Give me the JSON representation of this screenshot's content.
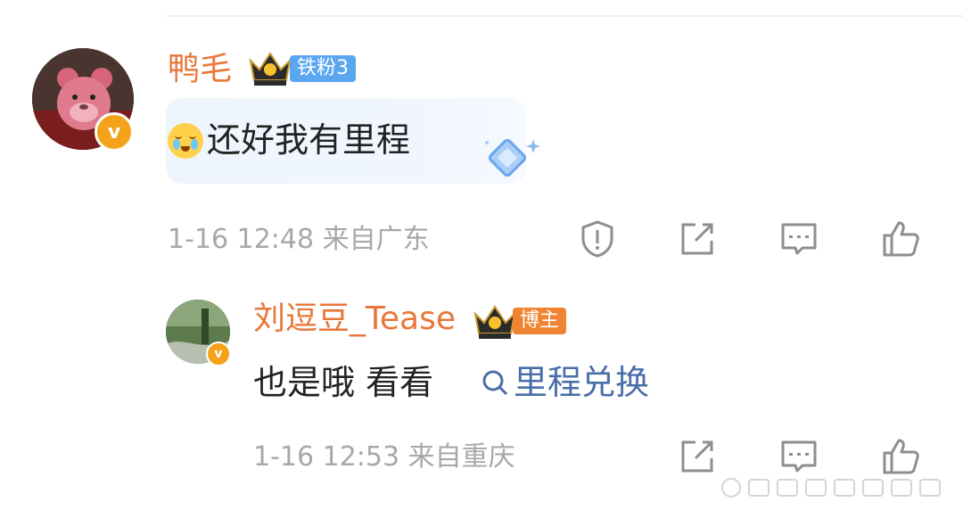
{
  "comment": {
    "username": "鸭毛",
    "fan_badge": "铁粉3",
    "text": "还好我有里程",
    "meta": "1-16 12:48 来自广东"
  },
  "reply": {
    "username": "刘逗豆_Tease",
    "host_badge": "博主",
    "text": "也是哦  看看",
    "search_link": "里程兑换",
    "meta": "1-16 12:53 来自重庆"
  },
  "verified_badge": "v",
  "icons": {
    "report": "report-shield-icon",
    "share": "share-icon",
    "reply": "reply-comment-icon",
    "like": "thumbs-up-icon",
    "search": "search-icon",
    "crown": "crown-icon",
    "diamond": "diamond-decoration-icon"
  },
  "colors": {
    "username": "#e8773a",
    "fan_badge": "#5aa7f0",
    "host_badge": "#f08432",
    "link": "#4a6ea9",
    "meta": "#a8a8a8",
    "verified": "#f3a21a"
  }
}
